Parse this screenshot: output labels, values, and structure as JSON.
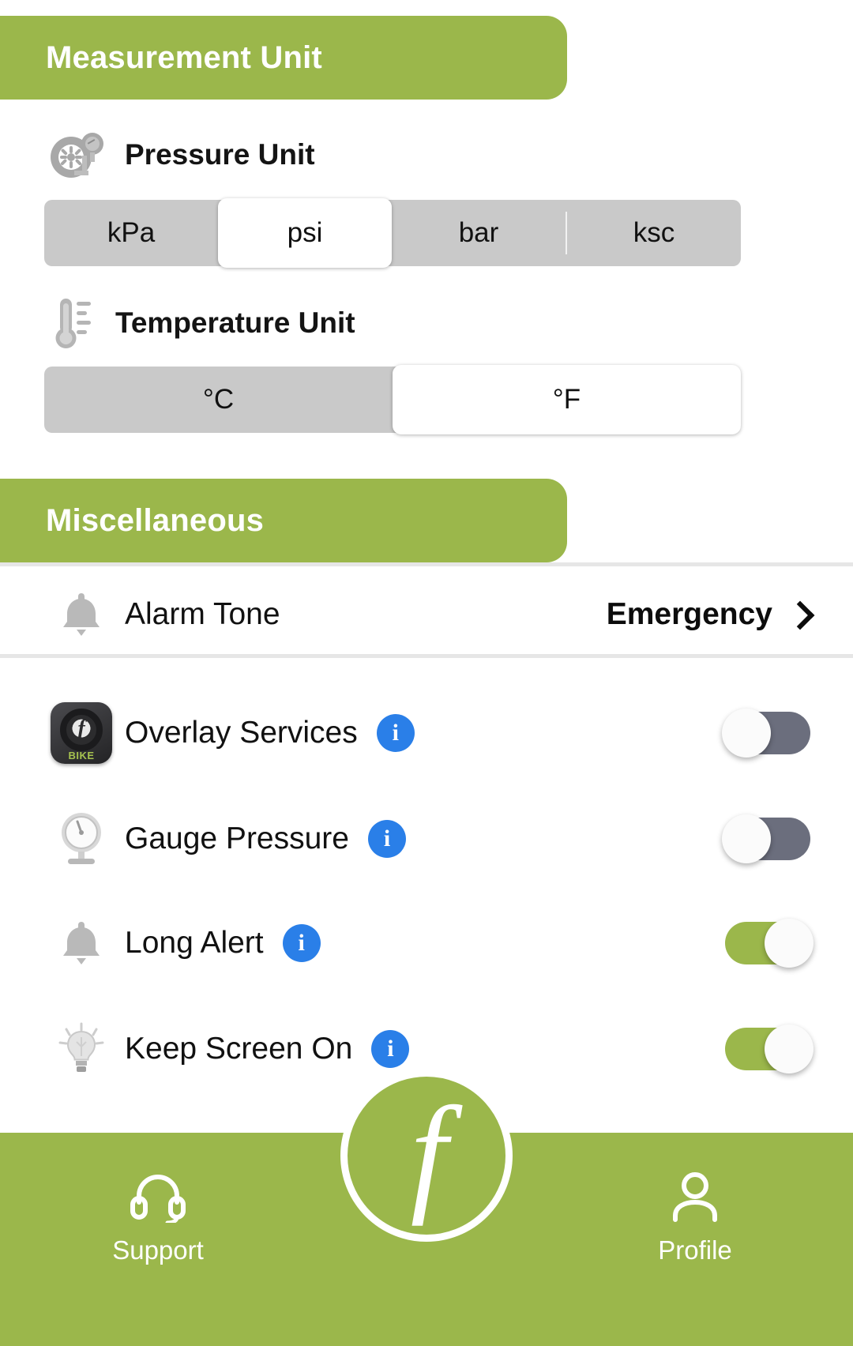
{
  "sections": {
    "measurement": {
      "title": "Measurement Unit"
    },
    "miscellaneous": {
      "title": "Miscellaneous"
    }
  },
  "pressure_unit": {
    "label": "Pressure Unit",
    "icon": "tire-pressure-gauge-icon",
    "options": [
      "kPa",
      "psi",
      "bar",
      "ksc"
    ],
    "selected": "psi"
  },
  "temperature_unit": {
    "label": "Temperature Unit",
    "icon": "thermometer-icon",
    "options": [
      "°C",
      "°F"
    ],
    "selected": "°F"
  },
  "alarm_tone": {
    "label": "Alarm Tone",
    "value": "Emergency",
    "icon": "bell-icon",
    "chevron": "chevron-right-icon"
  },
  "toggles": [
    {
      "label": "Overlay Services",
      "icon": "app-tire-bike-icon",
      "info": "i",
      "state": "off"
    },
    {
      "label": "Gauge Pressure",
      "icon": "gauge-dial-icon",
      "info": "i",
      "state": "off"
    },
    {
      "label": "Long Alert",
      "icon": "bell-icon",
      "info": "i",
      "state": "on"
    },
    {
      "label": "Keep Screen On",
      "icon": "lightbulb-icon",
      "info": "i",
      "state": "on"
    }
  ],
  "bottom_nav": {
    "support": {
      "label": "Support",
      "icon": "headset-icon"
    },
    "profile": {
      "label": "Profile",
      "icon": "person-icon"
    },
    "fab": {
      "glyph": "f",
      "name": "brand-logo-fab"
    }
  },
  "colors": {
    "brand_green": "#9bb74b",
    "toggle_off": "#6b6e7d",
    "info_blue": "#2a7fe8",
    "segment_track": "#c9c9c9"
  },
  "app_icon_text": "BIKE"
}
